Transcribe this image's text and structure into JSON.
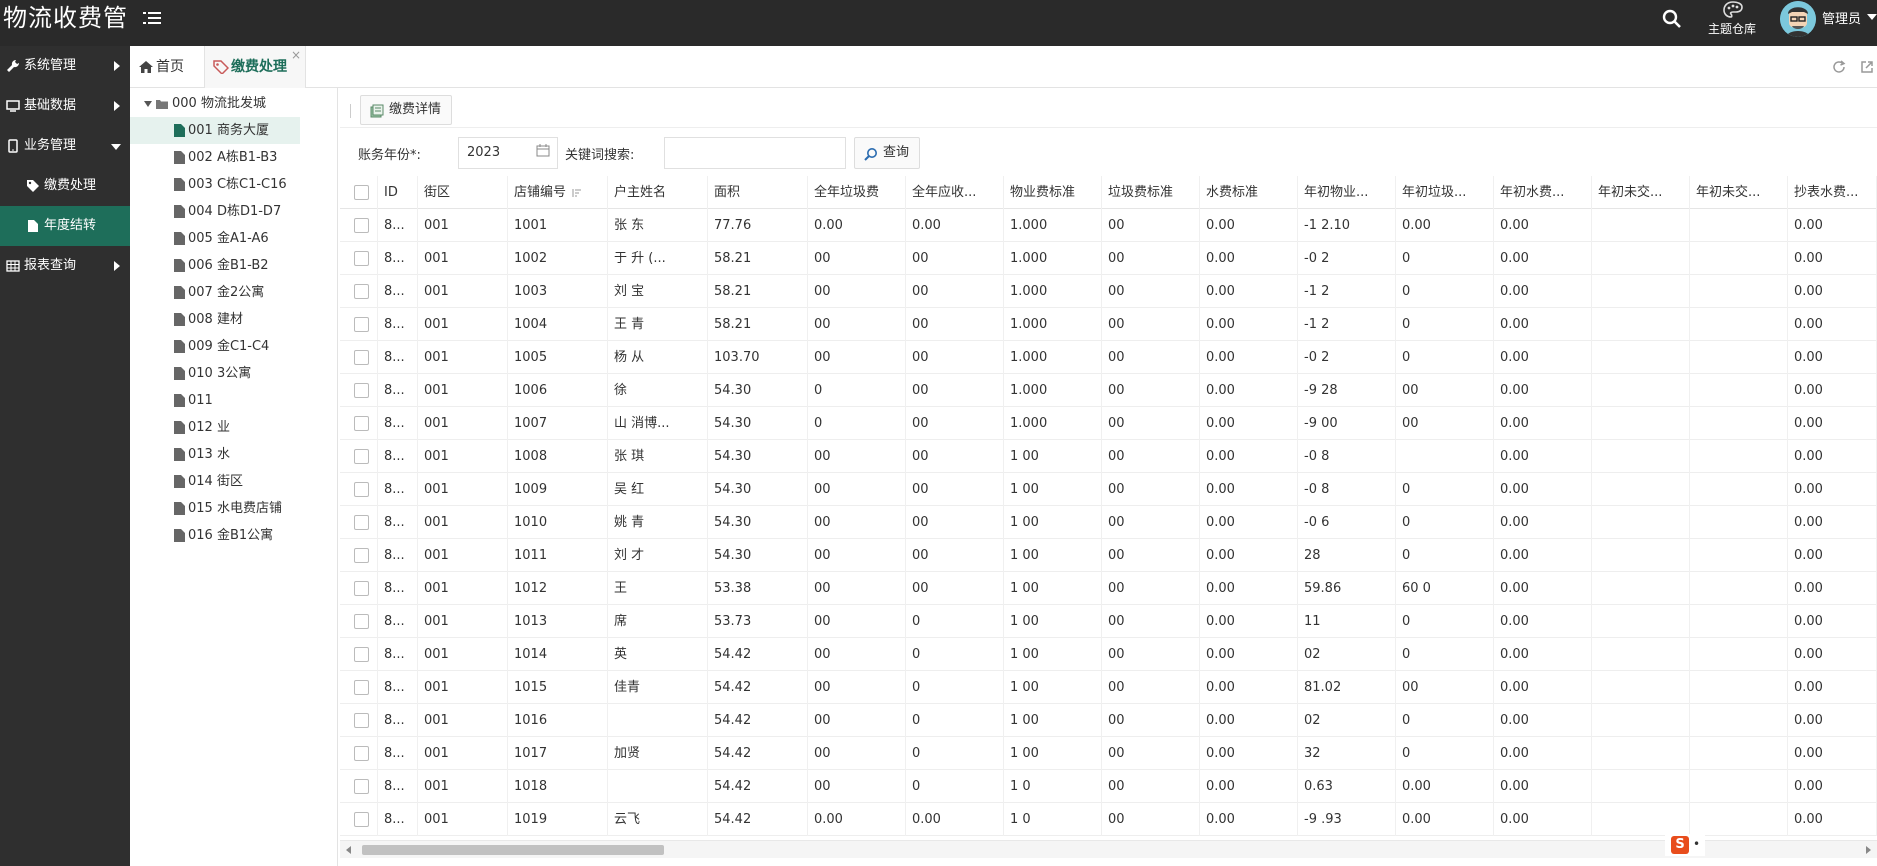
{
  "header": {
    "title": "物流收费管",
    "theme_label": "主题仓库",
    "user": "管理员"
  },
  "sidebar": {
    "items": [
      {
        "label": "系统管理",
        "icon": "wrench-icon",
        "arrow": "right",
        "level": 0
      },
      {
        "label": "基础数据",
        "icon": "monitor-icon",
        "arrow": "right",
        "level": 0
      },
      {
        "label": "业务管理",
        "icon": "mobile-icon",
        "arrow": "down",
        "level": 0
      },
      {
        "label": "缴费处理",
        "icon": "tag-icon",
        "arrow": "",
        "level": 1
      },
      {
        "label": "年度结转",
        "icon": "file-icon",
        "arrow": "",
        "level": 1,
        "active": true
      },
      {
        "label": "报表查询",
        "icon": "table-icon",
        "arrow": "right",
        "level": 0
      }
    ]
  },
  "tabs": [
    {
      "label": "首页",
      "icon": "home-icon"
    },
    {
      "label": "缴费处理",
      "icon": "tag-icon",
      "close": "×"
    }
  ],
  "tree": {
    "root": "000 物流批发城",
    "nodes": [
      "001 商务大厦",
      "002 A栋B1-B3",
      "003 C栋C1-C16",
      "004 D栋D1-D7",
      "005 金A1-A6",
      "006 金B1-B2",
      "007 金2公寓",
      "008 建材",
      "009 金C1-C4",
      "010 3公寓",
      "011",
      "012 业",
      "013 水",
      "014 街区",
      "015 水电费店铺",
      "016 金B1公寓"
    ],
    "selected": 0
  },
  "toolbar": {
    "detail_btn": "缴费详情"
  },
  "filter": {
    "year_label": "账务年份*:",
    "year_value": "2023",
    "keyword_label": "关键词搜索:",
    "keyword_value": "",
    "query_btn": "查询"
  },
  "table": {
    "columns": [
      "ID",
      "街区",
      "店铺编号",
      "户主姓名",
      "面积",
      "全年垃圾费",
      "全年应收...",
      "物业费标准",
      "垃圾费标准",
      "水费标准",
      "年初物业...",
      "年初垃圾...",
      "年初水费...",
      "年初未交...",
      "年初未交...",
      "抄表水费..."
    ],
    "rows": [
      [
        "8...",
        "001",
        "1001",
        "张 东",
        "77.76",
        "0.00",
        "0.00",
        "1.000",
        "00",
        "0.00",
        "-1 2.10",
        "0.00",
        "0.00",
        "",
        "",
        "0.00"
      ],
      [
        "8...",
        "001",
        "1002",
        "于 升 (...",
        "58.21",
        "00",
        "00",
        "1.000",
        "00",
        "0.00",
        "-0 2",
        "0",
        "0.00",
        "",
        "",
        "0.00"
      ],
      [
        "8...",
        "001",
        "1003",
        "刘 宝",
        "58.21",
        "00",
        "00",
        "1.000",
        "00",
        "0.00",
        "-1 2",
        "0",
        "0.00",
        "",
        "",
        "0.00"
      ],
      [
        "8...",
        "001",
        "1004",
        "王 青",
        "58.21",
        "00",
        "00",
        "1.000",
        "00",
        "0.00",
        "-1 2",
        "0",
        "0.00",
        "",
        "",
        "0.00"
      ],
      [
        "8...",
        "001",
        "1005",
        "杨 从",
        "103.70",
        "00",
        "00",
        "1.000",
        "00",
        "0.00",
        "-0 2",
        "0",
        "0.00",
        "",
        "",
        "0.00"
      ],
      [
        "8...",
        "001",
        "1006",
        "徐",
        "54.30",
        "0",
        "00",
        "1.000",
        "00",
        "0.00",
        "-9 28",
        "00",
        "0.00",
        "",
        "",
        "0.00"
      ],
      [
        "8...",
        "001",
        "1007",
        "山 消博...",
        "54.30",
        "0",
        "00",
        "1.000",
        "00",
        "0.00",
        "-9 00",
        "00",
        "0.00",
        "",
        "",
        "0.00"
      ],
      [
        "8...",
        "001",
        "1008",
        "张 琪",
        "54.30",
        "00",
        "00",
        "1 00",
        "00",
        "0.00",
        "-0 8",
        "",
        "0.00",
        "",
        "",
        "0.00"
      ],
      [
        "8...",
        "001",
        "1009",
        "吴 红",
        "54.30",
        "00",
        "00",
        "1 00",
        "00",
        "0.00",
        "-0 8",
        "0",
        "0.00",
        "",
        "",
        "0.00"
      ],
      [
        "8...",
        "001",
        "1010",
        "姚 青",
        "54.30",
        "00",
        "00",
        "1 00",
        "00",
        "0.00",
        "-0 6",
        "0",
        "0.00",
        "",
        "",
        "0.00"
      ],
      [
        "8...",
        "001",
        "1011",
        "刘 才",
        "54.30",
        "00",
        "00",
        "1 00",
        "00",
        "0.00",
        "28",
        "0",
        "0.00",
        "",
        "",
        "0.00"
      ],
      [
        "8...",
        "001",
        "1012",
        "王",
        "53.38",
        "00",
        "00",
        "1 00",
        "00",
        "0.00",
        "59.86",
        "60 0",
        "0.00",
        "",
        "",
        "0.00"
      ],
      [
        "8...",
        "001",
        "1013",
        "席",
        "53.73",
        "00",
        "0",
        "1 00",
        "00",
        "0.00",
        "11",
        "0",
        "0.00",
        "",
        "",
        "0.00"
      ],
      [
        "8...",
        "001",
        "1014",
        "英",
        "54.42",
        "00",
        "0",
        "1 00",
        "00",
        "0.00",
        "02",
        "0",
        "0.00",
        "",
        "",
        "0.00"
      ],
      [
        "8...",
        "001",
        "1015",
        "佳青",
        "54.42",
        "00",
        "0",
        "1 00",
        "00",
        "0.00",
        "81.02",
        "00",
        "0.00",
        "",
        "",
        "0.00"
      ],
      [
        "8...",
        "001",
        "1016",
        "",
        "54.42",
        "00",
        "0",
        "1 00",
        "00",
        "0.00",
        "02",
        "0",
        "0.00",
        "",
        "",
        "0.00"
      ],
      [
        "8...",
        "001",
        "1017",
        "加贤",
        "54.42",
        "00",
        "0",
        "1 00",
        "00",
        "0.00",
        "32",
        "0",
        "0.00",
        "",
        "",
        "0.00"
      ],
      [
        "8...",
        "001",
        "1018",
        "",
        "54.42",
        "00",
        "0",
        "1 0",
        "00",
        "0.00",
        "0.63",
        "0.00",
        "0.00",
        "",
        "",
        "0.00"
      ],
      [
        "8...",
        "001",
        "1019",
        "云飞",
        "54.42",
        "0.00",
        "0.00",
        "1 0",
        "00",
        "0.00",
        "-9 .93",
        "0.00",
        "0.00",
        "",
        "",
        "0.00"
      ]
    ]
  },
  "ime": {
    "logo": "S",
    "dots": "•"
  }
}
